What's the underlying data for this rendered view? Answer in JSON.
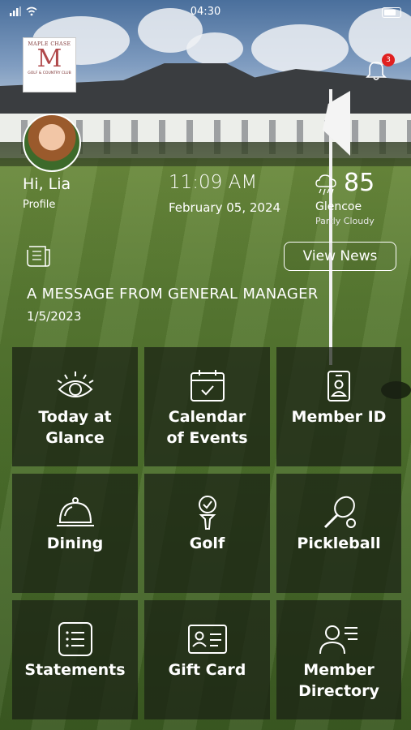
{
  "status_bar": {
    "time": "04:30"
  },
  "club_logo": {
    "arc_text": "MAPLE CHASE",
    "monogram": "M",
    "subtitle": "GOLF & COUNTRY CLUB"
  },
  "notifications": {
    "count": "3"
  },
  "profile": {
    "greeting": "Hi, Lia",
    "link_label": "Profile"
  },
  "clock": {
    "time": "11:09 AM",
    "date": "February  05, 2024"
  },
  "weather": {
    "temperature": "85",
    "location": "Glencoe",
    "condition": "Partly Cloudy",
    "icon": "rain-cloud-icon"
  },
  "news": {
    "button_label": "View News",
    "title": "A MESSAGE FROM GENERAL MANAGER",
    "date": "1/5/2023"
  },
  "tiles": [
    {
      "line1": "Today at",
      "line2": "Glance",
      "icon": "eye-icon"
    },
    {
      "line1": "Calendar",
      "line2": "of Events",
      "icon": "calendar-icon"
    },
    {
      "line1": "Member ID",
      "line2": "",
      "icon": "id-badge-icon"
    },
    {
      "line1": "Dining",
      "line2": "",
      "icon": "cloche-icon"
    },
    {
      "line1": "Golf",
      "line2": "",
      "icon": "golf-tee-icon"
    },
    {
      "line1": "Pickleball",
      "line2": "",
      "icon": "paddle-icon"
    },
    {
      "line1": "Statements",
      "line2": "",
      "icon": "list-icon"
    },
    {
      "line1": "Gift Card",
      "line2": "",
      "icon": "card-icon"
    },
    {
      "line1": "Member",
      "line2": "Directory",
      "icon": "directory-icon"
    }
  ]
}
